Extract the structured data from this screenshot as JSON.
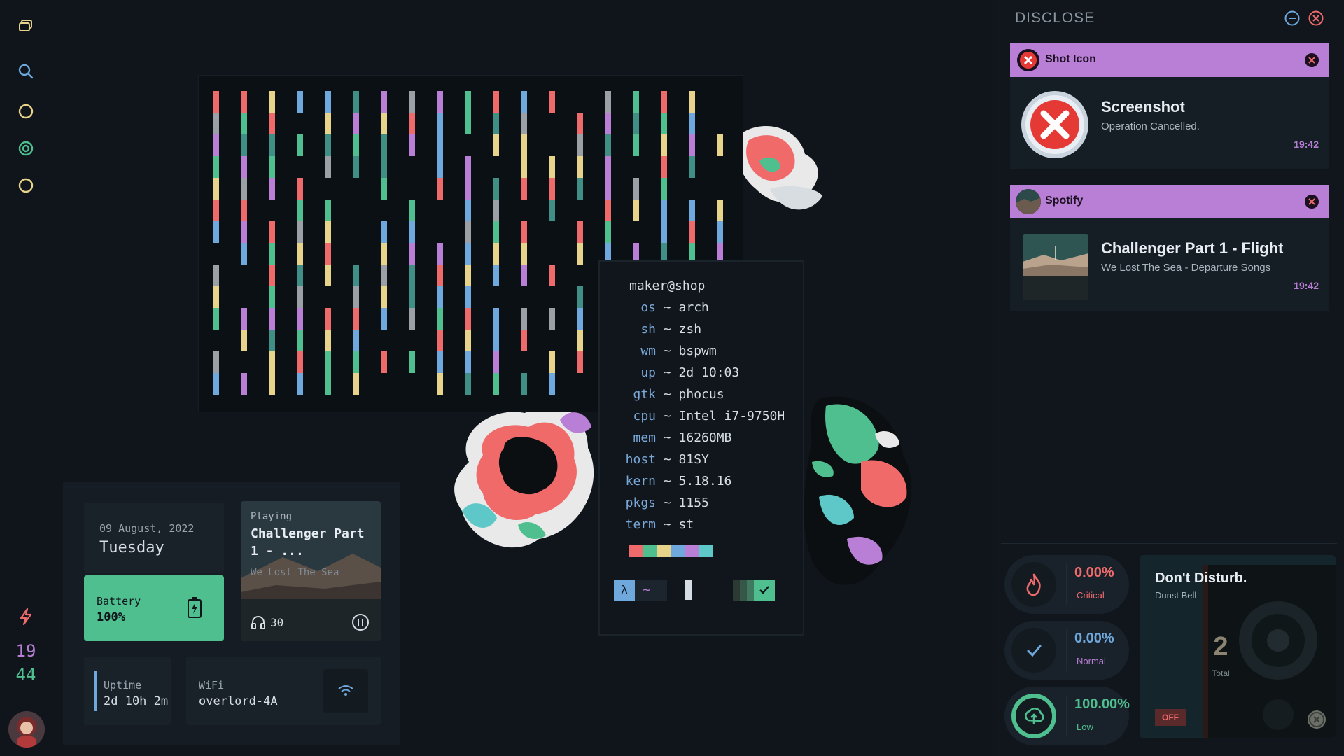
{
  "leftbar": {
    "icons": [
      "layers-icon",
      "search-icon",
      "circle-icon",
      "target-icon",
      "circle-icon",
      "bolt-icon"
    ],
    "clock_hour": "19",
    "clock_minute": "44"
  },
  "terminal": {
    "prompt_user": "maker@shop",
    "rows": [
      {
        "key": "os",
        "value": "arch"
      },
      {
        "key": "sh",
        "value": "zsh"
      },
      {
        "key": "wm",
        "value": "bspwm"
      },
      {
        "key": "up",
        "value": "2d 10:03"
      },
      {
        "key": "gtk",
        "value": "phocus"
      },
      {
        "key": "cpu",
        "value": "Intel i7-9750H"
      },
      {
        "key": "mem",
        "value": "16260MB"
      },
      {
        "key": "host",
        "value": "81SY"
      },
      {
        "key": "kern",
        "value": "5.18.16"
      },
      {
        "key": "pkgs",
        "value": "1155"
      },
      {
        "key": "term",
        "value": "st"
      }
    ],
    "palette": [
      "#ef6b6b",
      "#4fbf8f",
      "#e8d38a",
      "#6fa8dc",
      "#b97fd6",
      "#5ec8c8"
    ],
    "prompt_symbol": "λ",
    "prompt_dir": "~"
  },
  "dash": {
    "date": "09 August, 2022",
    "day": "Tuesday",
    "battery_label": "Battery",
    "battery_value": "100%",
    "music_state": "Playing",
    "music_title": "Challenger Part 1 - ...",
    "music_artist": "We Lost The Sea",
    "volume": "30",
    "uptime_label": "Uptime",
    "uptime_value": "2d 10h 2m",
    "wifi_label": "WiFi",
    "wifi_value": "overlord-4A"
  },
  "panel": {
    "title": "DISCLOSE",
    "notifications": [
      {
        "app": "Shot Icon",
        "title": "Screenshot",
        "body": "Operation Cancelled.",
        "time": "19:42"
      },
      {
        "app": "Spotify",
        "title": "Challenger Part 1 - Flight",
        "body": "We Lost The Sea - Departure Songs",
        "time": "19:42"
      }
    ],
    "stats": [
      {
        "value": "0.00%",
        "label": "Critical",
        "color": "#ef6b6b"
      },
      {
        "value": "0.00%",
        "label": "Normal",
        "color": "#6fa8dc"
      },
      {
        "value": "100.00%",
        "label": "Low",
        "color": "#4fbf8f"
      }
    ],
    "dnd_title": "Don't Disturb.",
    "dnd_subtitle": "Dunst Bell",
    "dnd_count": "2",
    "dnd_count_label": "Total",
    "dnd_toggle": "OFF"
  },
  "colors": {
    "accent_purple": "#b97fd6",
    "accent_green": "#4fbf8f",
    "accent_red": "#ef6b6b",
    "accent_blue": "#6fa8dc",
    "accent_yellow": "#e8d38a"
  }
}
